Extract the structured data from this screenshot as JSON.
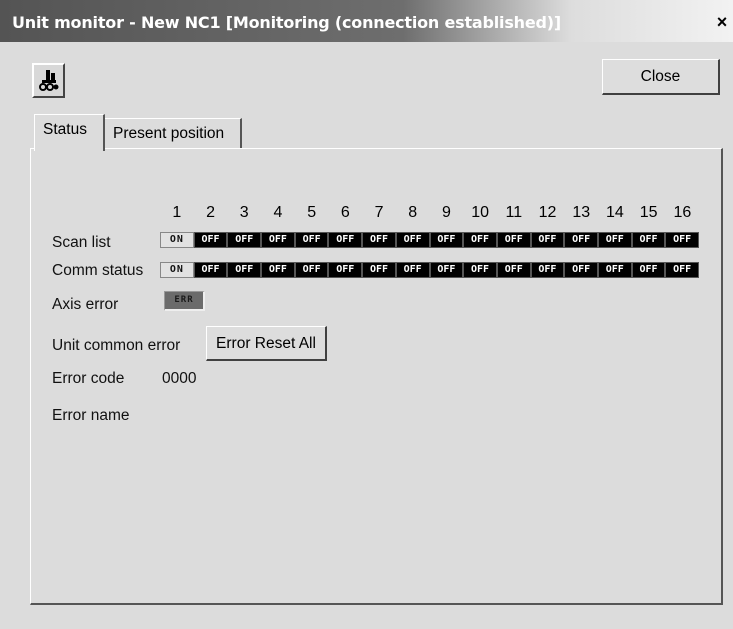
{
  "window": {
    "title": "Unit monitor - New NC1 [Monitoring (connection established)]",
    "close_glyph": "×"
  },
  "toolbar": {
    "close_label": "Close",
    "app_icon": "unit-monitor-icon"
  },
  "tabs": [
    {
      "label": "Status",
      "active": true
    },
    {
      "label": "Present position",
      "active": false
    }
  ],
  "status": {
    "columns": [
      "1",
      "2",
      "3",
      "4",
      "5",
      "6",
      "7",
      "8",
      "9",
      "10",
      "11",
      "12",
      "13",
      "14",
      "15",
      "16"
    ],
    "scan_list": {
      "label": "Scan list",
      "values": [
        "ON",
        "OFF",
        "OFF",
        "OFF",
        "OFF",
        "OFF",
        "OFF",
        "OFF",
        "OFF",
        "OFF",
        "OFF",
        "OFF",
        "OFF",
        "OFF",
        "OFF",
        "OFF"
      ]
    },
    "comm_status": {
      "label": "Comm status",
      "values": [
        "ON",
        "OFF",
        "OFF",
        "OFF",
        "OFF",
        "OFF",
        "OFF",
        "OFF",
        "OFF",
        "OFF",
        "OFF",
        "OFF",
        "OFF",
        "OFF",
        "OFF",
        "OFF"
      ]
    },
    "axis_error": {
      "label": "Axis error",
      "indicator": "ERR"
    },
    "unit_common_error": {
      "label": "Unit common error",
      "reset_button": "Error Reset All"
    },
    "error_code": {
      "label": "Error code",
      "value": "0000"
    },
    "error_name": {
      "label": "Error name",
      "value": ""
    }
  },
  "colors": {
    "on_cell": "#e2e2e2",
    "off_cell": "#000000",
    "err_indicator": "#6b6b6b"
  }
}
